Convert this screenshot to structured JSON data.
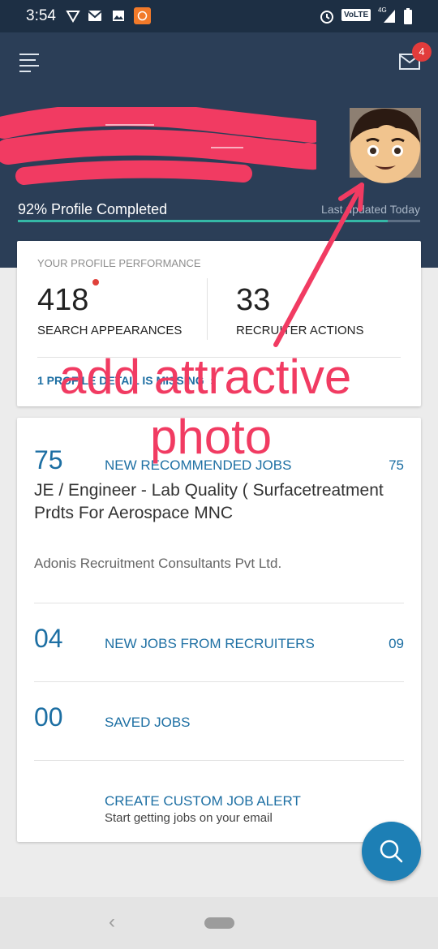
{
  "status_bar": {
    "time": "3:54",
    "network_badge": "VoLTE",
    "signal_type": "4G"
  },
  "header": {
    "notification_count": "4",
    "profile_completion_text": "92% Profile Completed",
    "profile_completion_value": 0.92,
    "last_updated_text": "Last updated Today"
  },
  "performance": {
    "title": "YOUR PROFILE PERFORMANCE",
    "search_appearances": {
      "value": "418",
      "label": "SEARCH APPEARANCES"
    },
    "recruiter_actions": {
      "value": "33",
      "label": "RECRUITER ACTIONS"
    },
    "missing_detail_link": "1 PROFILE DETAIL IS MISSING"
  },
  "jobs": {
    "recommended": {
      "number": "75",
      "label": "NEW RECOMMENDED JOBS",
      "count": "75",
      "job_title": "JE / Engineer - Lab Quality ( Surfacetreatment Prdts For Aerospace MNC",
      "company": "Adonis Recruitment Consultants Pvt Ltd."
    },
    "from_recruiters": {
      "number": "04",
      "label": "NEW JOBS FROM RECRUITERS",
      "count": "09"
    },
    "saved": {
      "number": "00",
      "label": "SAVED JOBS"
    },
    "alert": {
      "label": "CREATE CUSTOM JOB ALERT",
      "sub": "Start getting jobs on your email"
    }
  },
  "annotation": {
    "line1": "add attractive",
    "line2": "photo"
  },
  "icons": {
    "menu": "hamburger-icon",
    "mail": "mail-icon",
    "fab": "search-icon",
    "nav_back": "back-icon",
    "nav_home": "home-pill-icon"
  },
  "colors": {
    "header_bg": "#2b3e57",
    "accent_blue": "#1d6fa3",
    "progress": "#35b8a6",
    "annotation": "#f13b62",
    "badge": "#e23b3b"
  }
}
